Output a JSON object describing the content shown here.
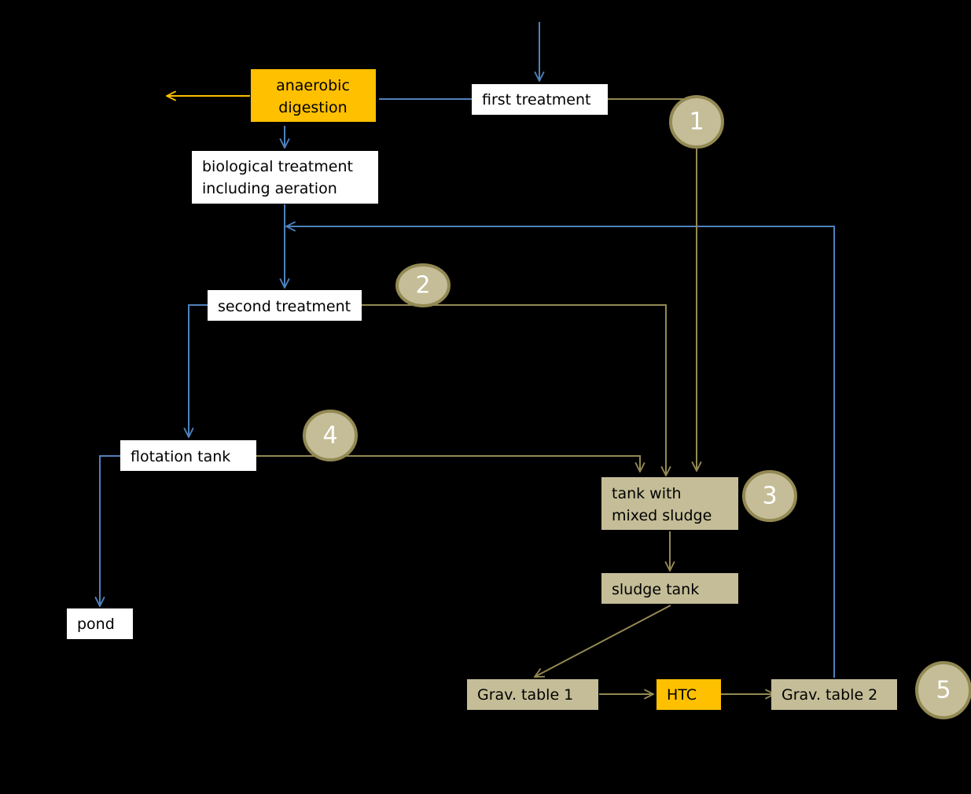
{
  "colors": {
    "background": "#000000",
    "blue_flow": "#4F81BD",
    "olive_flow": "#938953",
    "tan_box": "#C4BD97",
    "orange_box": "#FFC000",
    "white_box": "#FFFFFF"
  },
  "nodes": {
    "anaerobic_digestion": [
      "anaerobic",
      "digestion"
    ],
    "first_treatment": "first treatment",
    "biological_treatment": [
      "biological treatment",
      "including aeration"
    ],
    "second_treatment": "second treatment",
    "flotation_tank": "flotation tank",
    "pond": "pond",
    "tank_mixed_sludge": [
      "tank with",
      "mixed sludge"
    ],
    "sludge_tank": "sludge tank",
    "grav_table_1": "Grav. table 1",
    "htc": "HTC",
    "grav_table_2": "Grav. table 2"
  },
  "markers": [
    "1",
    "2",
    "3",
    "4",
    "5"
  ]
}
